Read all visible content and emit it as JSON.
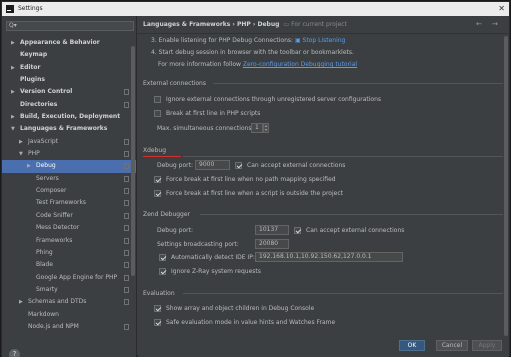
{
  "window": {
    "title": "Settings",
    "close": "✕"
  },
  "search": {
    "icon": "search-icon",
    "value": ""
  },
  "tree": [
    {
      "label": "Appearance & Behavior",
      "arrow": "▶",
      "bold": true
    },
    {
      "label": "Keymap",
      "bold": true
    },
    {
      "label": "Editor",
      "arrow": "▶",
      "bold": true
    },
    {
      "label": "Plugins",
      "bold": true
    },
    {
      "label": "Version Control",
      "arrow": "▶",
      "bold": true,
      "copy": true
    },
    {
      "label": "Directories",
      "bold": true,
      "copy": true
    },
    {
      "label": "Build, Execution, Deployment",
      "arrow": "▶",
      "bold": true
    },
    {
      "label": "Languages & Frameworks",
      "arrow": "▼",
      "bold": true
    },
    {
      "label": "JavaScript",
      "arrow": "▶",
      "copy": true
    },
    {
      "label": "PHP",
      "arrow": "▼",
      "copy": true
    },
    {
      "label": "Debug",
      "arrow": "▶",
      "copy": true,
      "selected": true
    },
    {
      "label": "Servers",
      "copy": true
    },
    {
      "label": "Composer",
      "copy": true
    },
    {
      "label": "Test Frameworks",
      "copy": true
    },
    {
      "label": "Code Sniffer",
      "copy": true
    },
    {
      "label": "Mess Detector",
      "copy": true
    },
    {
      "label": "Frameworks",
      "copy": true
    },
    {
      "label": "Phing",
      "copy": true
    },
    {
      "label": "Blade",
      "copy": true
    },
    {
      "label": "Google App Engine for PHP",
      "copy": true
    },
    {
      "label": "Smarty",
      "copy": true
    },
    {
      "label": "Schemas and DTDs",
      "arrow": "▶",
      "copy": true
    },
    {
      "label": "Markdown"
    },
    {
      "label": "Node.js and NPM",
      "copy": true
    }
  ],
  "breadcrumb": {
    "parts": [
      "Languages & Frameworks",
      "PHP",
      "Debug"
    ],
    "scope": "For current project",
    "back": "←",
    "forward": "→"
  },
  "steps": {
    "step3_prefix": "3. Enable listening for PHP Debug Connections:",
    "stop_listening": "Stop Listening",
    "step4": "4. Start debug session in browser with the toolbar or bookmarklets.",
    "more_info_prefix": "For more information follow",
    "more_info_link": "Zero-configuration Debugging tutorial"
  },
  "external": {
    "title": "External connections",
    "ignore_external": {
      "label": "Ignore external connections through unregistered server configurations",
      "checked": false
    },
    "break_first_line": {
      "label": "Break at first line in PHP scripts",
      "checked": false
    },
    "max_connections": {
      "label": "Max. simultaneous connections:",
      "value": "1"
    }
  },
  "xdebug": {
    "title": "Xdebug",
    "debug_port": {
      "label": "Debug port:",
      "value": "9000"
    },
    "accept_external": {
      "label": "Can accept external connections",
      "checked": true
    },
    "force_break_no_mapping": {
      "label": "Force break at first line when no path mapping specified",
      "checked": true
    },
    "force_break_outside": {
      "label": "Force break at first line when a script is outside the project",
      "checked": true
    }
  },
  "zend": {
    "title": "Zend Debugger",
    "debug_port": {
      "label": "Debug port:",
      "value": "10137"
    },
    "accept_external": {
      "label": "Can accept external connections",
      "checked": true
    },
    "broadcast_port": {
      "label": "Settings broadcasting port:",
      "value": "20080"
    },
    "auto_detect_ip": {
      "label": "Automatically detect IDE IP:",
      "value": "192.168.10.1,10.92.150.62,127.0.0.1",
      "checked": true
    },
    "ignore_zray": {
      "label": "Ignore Z-Ray system requests",
      "checked": true
    }
  },
  "evaluation": {
    "title": "Evaluation",
    "show_arrays": {
      "label": "Show array and object children in Debug Console",
      "checked": true
    },
    "safe_eval": {
      "label": "Safe evaluation mode in value hints and Watches Frame",
      "checked": true
    }
  },
  "buttons": {
    "ok": "OK",
    "cancel": "Cancel",
    "apply": "Apply",
    "help": "?"
  },
  "colors": {
    "accent": "#4b6eaf",
    "link": "#589df6",
    "xdebug_underline": "#d32f2f",
    "background": "#3c3f41"
  }
}
